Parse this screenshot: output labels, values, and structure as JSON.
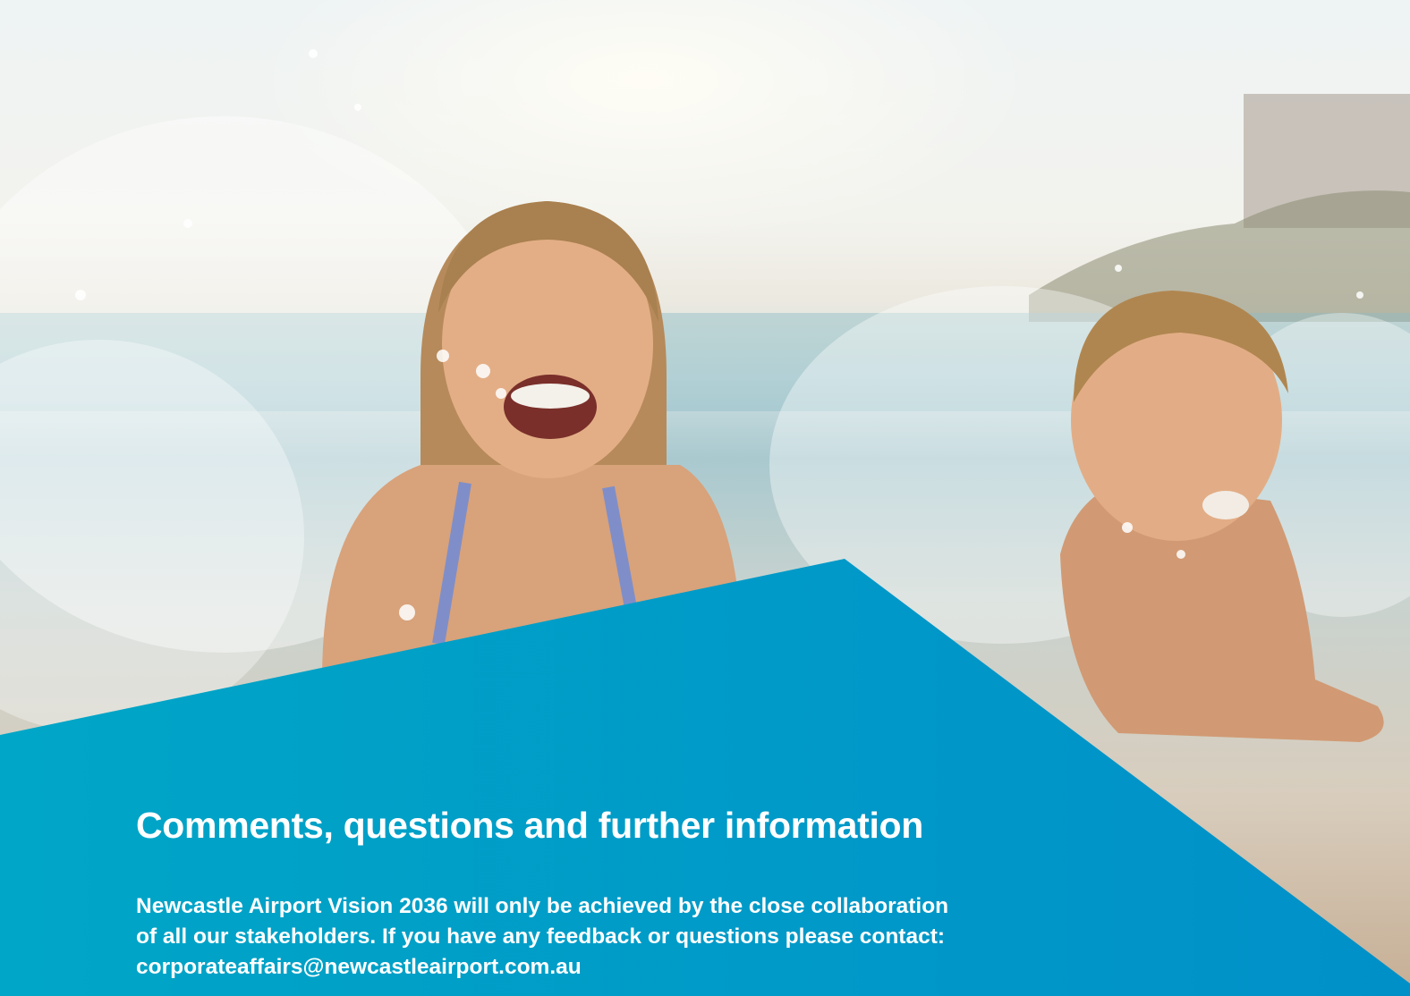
{
  "photo": {
    "description_icon": "photo-children-splashing-in-sea"
  },
  "panel": {
    "color_light": "#00a6c7",
    "color_dark": "#0090c8"
  },
  "heading": "Comments, questions and further information",
  "body": {
    "line1": "Newcastle Airport Vision 2036 will only be achieved by the close collaboration",
    "line2": "of all our stakeholders. If you have any feedback or questions please contact:",
    "email": "corporateaffairs@newcastleairport.com.au"
  }
}
